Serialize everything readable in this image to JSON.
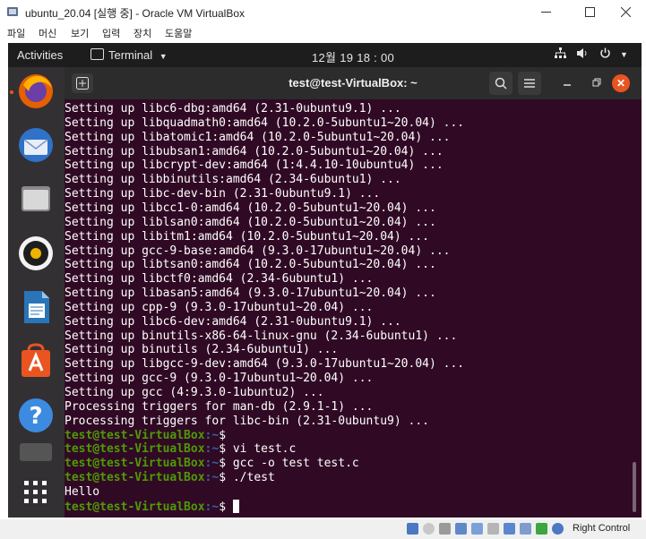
{
  "host": {
    "title": "ubuntu_20.04 [실행 중] - Oracle VM VirtualBox",
    "menu": [
      "파일",
      "머신",
      "보기",
      "입력",
      "장치",
      "도움말"
    ],
    "host_key": "Right Control"
  },
  "gnome": {
    "activities": "Activities",
    "app_menu": "Terminal",
    "clock": "12월 19 18 : 00"
  },
  "dock": {
    "items": [
      "firefox-icon",
      "thunderbird-icon",
      "files-icon",
      "rhythmbox-icon",
      "writer-icon",
      "software-icon",
      "help-icon",
      "show-apps-icon"
    ]
  },
  "terminal": {
    "title": "test@test-VirtualBox: ~",
    "output": [
      "Setting up libc6-dbg:amd64 (2.31-0ubuntu9.1) ...",
      "Setting up libquadmath0:amd64 (10.2.0-5ubuntu1~20.04) ...",
      "Setting up libatomic1:amd64 (10.2.0-5ubuntu1~20.04) ...",
      "Setting up libubsan1:amd64 (10.2.0-5ubuntu1~20.04) ...",
      "Setting up libcrypt-dev:amd64 (1:4.4.10-10ubuntu4) ...",
      "Setting up libbinutils:amd64 (2.34-6ubuntu1) ...",
      "Setting up libc-dev-bin (2.31-0ubuntu9.1) ...",
      "Setting up libcc1-0:amd64 (10.2.0-5ubuntu1~20.04) ...",
      "Setting up liblsan0:amd64 (10.2.0-5ubuntu1~20.04) ...",
      "Setting up libitm1:amd64 (10.2.0-5ubuntu1~20.04) ...",
      "Setting up gcc-9-base:amd64 (9.3.0-17ubuntu1~20.04) ...",
      "Setting up libtsan0:amd64 (10.2.0-5ubuntu1~20.04) ...",
      "Setting up libctf0:amd64 (2.34-6ubuntu1) ...",
      "Setting up libasan5:amd64 (9.3.0-17ubuntu1~20.04) ...",
      "Setting up cpp-9 (9.3.0-17ubuntu1~20.04) ...",
      "Setting up libc6-dev:amd64 (2.31-0ubuntu9.1) ...",
      "Setting up binutils-x86-64-linux-gnu (2.34-6ubuntu1) ...",
      "Setting up binutils (2.34-6ubuntu1) ...",
      "Setting up libgcc-9-dev:amd64 (9.3.0-17ubuntu1~20.04) ...",
      "Setting up gcc-9 (9.3.0-17ubuntu1~20.04) ...",
      "Setting up gcc (4:9.3.0-1ubuntu2) ...",
      "Processing triggers for man-db (2.9.1-1) ...",
      "Processing triggers for libc-bin (2.31-0ubuntu9) ..."
    ],
    "prompt_user": "test@test-VirtualBox",
    "prompt_path": ":~",
    "prompt_symbol": "$",
    "session": [
      {
        "type": "prompt",
        "cmd": ""
      },
      {
        "type": "prompt",
        "cmd": " vi test.c"
      },
      {
        "type": "prompt",
        "cmd": " gcc -o test test.c"
      },
      {
        "type": "prompt",
        "cmd": " ./test"
      },
      {
        "type": "output",
        "text": "Hello"
      },
      {
        "type": "prompt",
        "cmd": " "
      }
    ]
  },
  "colors": {
    "terminal_bg": "#300a24",
    "prompt_user": "#4e9a06",
    "prompt_path": "#3465a4",
    "accent": "#e95420"
  }
}
